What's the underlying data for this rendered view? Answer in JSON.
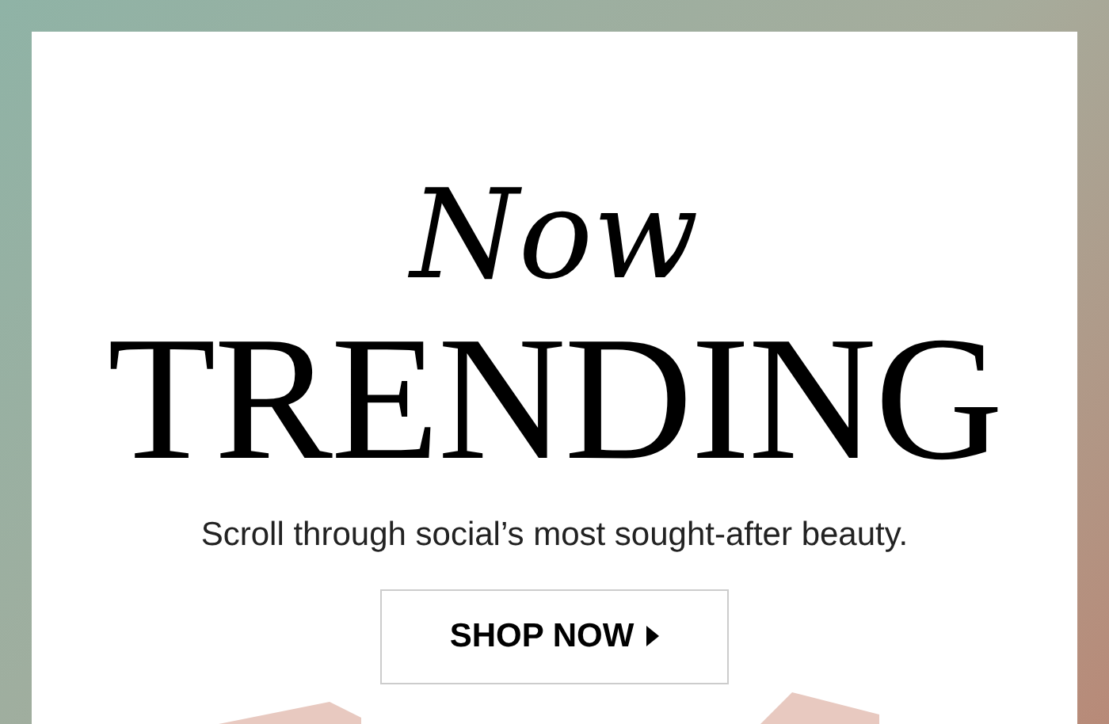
{
  "headline_script": "Now",
  "headline": "TRENDING",
  "subtitle": "Scroll through social’s most sought-after beauty.",
  "button": {
    "label": "SHOP NOW"
  }
}
